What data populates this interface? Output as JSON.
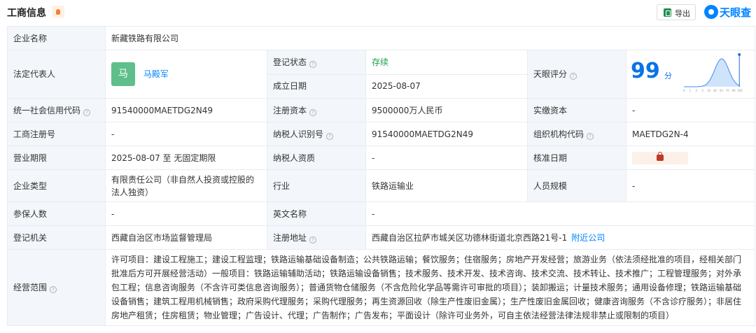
{
  "header": {
    "title": "工商信息",
    "export_label": "导出",
    "brand": "天眼查"
  },
  "rows": {
    "company_name_label": "企业名称",
    "company_name": "新藏铁路有限公司",
    "legal_rep_label": "法定代表人",
    "legal_rep_avatar": "马",
    "legal_rep_name": "马殿军",
    "reg_status_label": "登记状态",
    "reg_status": "存续",
    "established_label": "成立日期",
    "established": "2025-08-07",
    "score_label": "天眼评分",
    "score_value": "99",
    "score_unit": "分",
    "credit_code_label": "统一社会信用代码",
    "credit_code": "91540000MAETDG2N49",
    "reg_capital_label": "注册资本",
    "reg_capital": "9500000万人民币",
    "paid_capital_label": "实缴资本",
    "paid_capital": "-",
    "biz_reg_no_label": "工商注册号",
    "biz_reg_no": "-",
    "taxpayer_id_label": "纳税人识别号",
    "taxpayer_id": "91540000MAETDG2N49",
    "org_code_label": "组织机构代码",
    "org_code": "MAETDG2N-4",
    "term_label": "营业期限",
    "term": "2025-08-07 至 无固定期限",
    "taxpayer_quality_label": "纳税人资质",
    "taxpayer_quality": "-",
    "approval_date_label": "核准日期",
    "company_type_label": "企业类型",
    "company_type": "有限责任公司（非自然人投资或控股的法人独资）",
    "industry_label": "行业",
    "industry": "铁路运输业",
    "staff_size_label": "人员规模",
    "staff_size": "-",
    "insured_label": "参保人数",
    "insured": "-",
    "english_name_label": "英文名称",
    "english_name": "-",
    "authority_label": "登记机关",
    "authority": "西藏自治区市场监督管理局",
    "address_label": "注册地址",
    "address": "西藏自治区拉萨市城关区功德林街道北京西路21号-1",
    "nearby_link": "附近公司",
    "scope_label": "经营范围",
    "scope": "许可项目：建设工程施工；建设工程监理；铁路运输基础设备制造；公共铁路运输；餐饮服务；住宿服务；房地产开发经营；旅游业务（依法须经批准的项目，经相关部门批准后方可开展经营活动）一般项目：铁路运输辅助活动；铁路运输设备销售；技术服务、技术开发、技术咨询、技术交流、技术转让、技术推广；工程管理服务；对外承包工程；信息咨询服务（不含许可类信息咨询服务）；普通货物仓储服务（不含危险化学品等需许可审批的项目）；装卸搬运；计量技术服务；通用设备修理；铁路运输基础设备销售；建筑工程用机械销售；政府采购代理服务；采购代理服务；再生资源回收（除生产性废旧金属）；生产性废旧金属回收；健康咨询服务（不含诊疗服务）；非居住房地产租赁；住房租赁；物业管理；广告设计、代理；广告制作；广告发布；平面设计（除许可业务外，可自主依法经营法律法规非禁止或限制的项目）"
  },
  "score_chart": {
    "x_ticks": [
      "0",
      "1",
      "2",
      "3",
      "10",
      "40",
      "50",
      "70",
      "90",
      "100"
    ],
    "highlight": 99
  },
  "colors": {
    "accent": "#0084ff",
    "label_bg": "#f3f6fa",
    "border": "#e8ecf1",
    "status_green": "#1a9f4a",
    "score_blue": "#0a73e8"
  }
}
